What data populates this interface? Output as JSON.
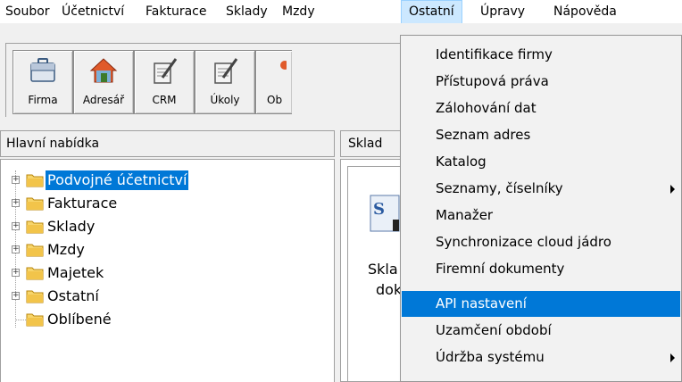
{
  "menubar": {
    "items": [
      {
        "label": "Soubor"
      },
      {
        "label": "Účetnictví"
      },
      {
        "label": "Fakturace"
      },
      {
        "label": "Sklady"
      },
      {
        "label": "Mzdy"
      },
      {
        "label": "Ostatní"
      },
      {
        "label": "Úpravy"
      },
      {
        "label": "Nápověda"
      }
    ]
  },
  "toolbar": {
    "buttons": [
      {
        "label": "Firma",
        "icon": "briefcase-icon"
      },
      {
        "label": "Adresář",
        "icon": "house-icon"
      },
      {
        "label": "CRM",
        "icon": "notepad-icon"
      },
      {
        "label": "Úkoly",
        "icon": "notepad-icon"
      },
      {
        "label": "Ob",
        "icon": "partial-icon"
      }
    ]
  },
  "left_panel": {
    "title": "Hlavní nabídka",
    "tree": [
      {
        "label": "Podvojné účetnictví",
        "selected": true
      },
      {
        "label": "Fakturace"
      },
      {
        "label": "Sklady"
      },
      {
        "label": "Mzdy"
      },
      {
        "label": "Majetek"
      },
      {
        "label": "Ostatní"
      },
      {
        "label": "Oblíbené"
      }
    ]
  },
  "right_panel": {
    "tab_label": "Sklad",
    "text_line1": "Skla",
    "text_line2": "dok"
  },
  "dropdown": {
    "items": [
      {
        "label": "Identifikace firmy"
      },
      {
        "label": "Přístupová práva"
      },
      {
        "label": "Zálohování dat"
      },
      {
        "label": "Seznam adres"
      },
      {
        "label": "Katalog"
      },
      {
        "label": "Seznamy, číselníky",
        "submenu": true
      },
      {
        "label": "Manažer"
      },
      {
        "label": "Synchronizace cloud jádro"
      },
      {
        "label": "Firemní dokumenty"
      },
      {
        "label": "API nastavení",
        "highlighted": true
      },
      {
        "label": "Uzamčení období"
      },
      {
        "label": "Údržba systému",
        "submenu": true
      }
    ]
  },
  "colors": {
    "selection": "#0078d7",
    "menu_open": "#cce8ff",
    "folder": "#e8b93a"
  }
}
